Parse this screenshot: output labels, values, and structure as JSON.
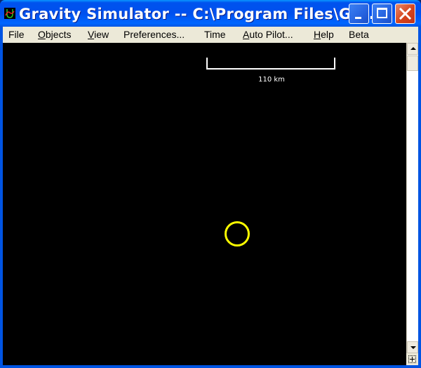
{
  "window": {
    "title": "Gravity Simulator -- C:\\Program Files\\Gra...",
    "icon": "gravity-simulator-app-icon",
    "controls": {
      "minimize": "minimize-icon",
      "maximize": "maximize-icon",
      "close": "close-icon"
    }
  },
  "menubar": {
    "items": [
      {
        "label": "File",
        "underline": ""
      },
      {
        "label": "Objects",
        "underline": "O"
      },
      {
        "label": "View",
        "underline": "V"
      },
      {
        "label": "Preferences...",
        "underline": ""
      },
      {
        "label": "Time",
        "underline": ""
      },
      {
        "label": "Auto Pilot...",
        "underline": "A"
      },
      {
        "label": "Help",
        "underline": "H"
      },
      {
        "label": "Beta",
        "underline": ""
      }
    ]
  },
  "canvas": {
    "background": "#000000",
    "scale": {
      "label": "110 km"
    },
    "objects": [
      {
        "name": "yellow-body",
        "color": "#ffff00"
      }
    ]
  },
  "scrollbar": {
    "up": "scroll-up-arrow-icon",
    "down": "scroll-down-arrow-icon"
  }
}
